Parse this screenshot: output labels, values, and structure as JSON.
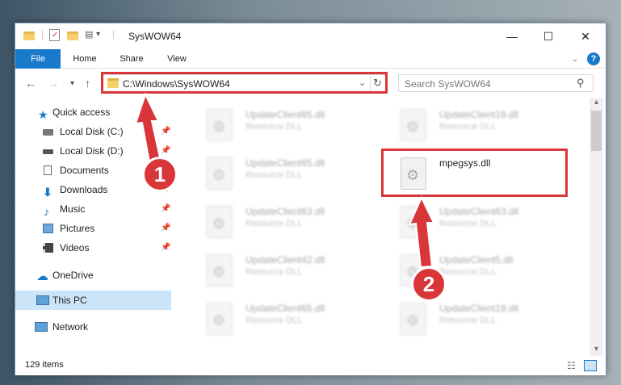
{
  "window": {
    "title": "SysWOW64"
  },
  "ribbon": {
    "tabs": [
      "File",
      "Home",
      "Share",
      "View"
    ]
  },
  "address": {
    "path": "C:\\Windows\\SysWOW64"
  },
  "search": {
    "placeholder": "Search SysWOW64"
  },
  "sidebar": {
    "items": [
      {
        "label": "Quick access"
      },
      {
        "label": "Local Disk (C:)"
      },
      {
        "label": "Local Disk (D:)"
      },
      {
        "label": "Documents"
      },
      {
        "label": "Downloads"
      },
      {
        "label": "Music"
      },
      {
        "label": "Pictures"
      },
      {
        "label": "Videos"
      },
      {
        "label": "OneDrive"
      },
      {
        "label": "This PC"
      },
      {
        "label": "Network"
      }
    ]
  },
  "files": [
    {
      "name": "UpdateClient65.dll",
      "type": "Resource DLL"
    },
    {
      "name": "UpdateClient19.dll",
      "type": "Resource DLL"
    },
    {
      "name": "UpdateClient65.dll",
      "type": "Resource DLL"
    },
    {
      "name": "mpegsys.dll",
      "type": ""
    },
    {
      "name": "UpdateClient63.dll",
      "type": "Resource DLL"
    },
    {
      "name": "UpdateClient63.dll",
      "type": "Resource DLL"
    },
    {
      "name": "UpdateClient42.dll",
      "type": "Resource DLL"
    },
    {
      "name": "UpdateClient5.dll",
      "type": "Resource DLL"
    },
    {
      "name": "UpdateClient65.dll",
      "type": "Resource DLL"
    },
    {
      "name": "UpdateClient19.dll",
      "type": "Resource DLL"
    }
  ],
  "status": {
    "count": "129 items"
  },
  "annotations": {
    "step1": "1",
    "step2": "2"
  },
  "colors": {
    "accent": "#1979ca",
    "highlight": "#d9363a",
    "selection": "#cce4f7"
  }
}
